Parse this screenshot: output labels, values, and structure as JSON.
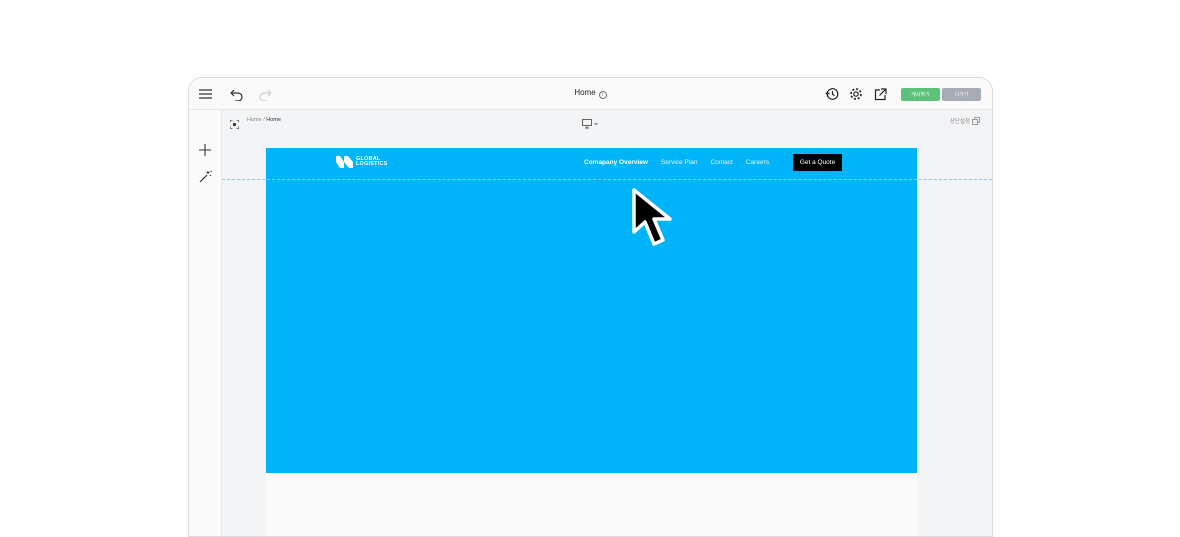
{
  "topbar": {
    "page_title": "Home",
    "info_icon": "info-icon",
    "publish_label": "게시하기",
    "exit_label": "나가기",
    "icons": [
      "menu-icon",
      "undo-icon",
      "redo-icon",
      "history-icon",
      "gear-icon",
      "external-link-icon"
    ]
  },
  "leftbar": {
    "icons": [
      "plus-icon",
      "magic-wand-icon"
    ]
  },
  "subbar": {
    "breadcrumb_root": "Home",
    "breadcrumb_separator": "/",
    "breadcrumb_current": "Home",
    "section_setting_label": "상단설정"
  },
  "site": {
    "logo_line1": "GLOBAL",
    "logo_line2": "LOGISTICS",
    "nav": [
      "Comapany Overview",
      "Service Plan",
      "Contact",
      "Careers"
    ],
    "cta_label": "Get a Quote",
    "hero_color": "#00b4fa"
  },
  "colors": {
    "publish": "#5cc27a",
    "exit": "#a7abb3",
    "accent": "#00b4fa"
  }
}
